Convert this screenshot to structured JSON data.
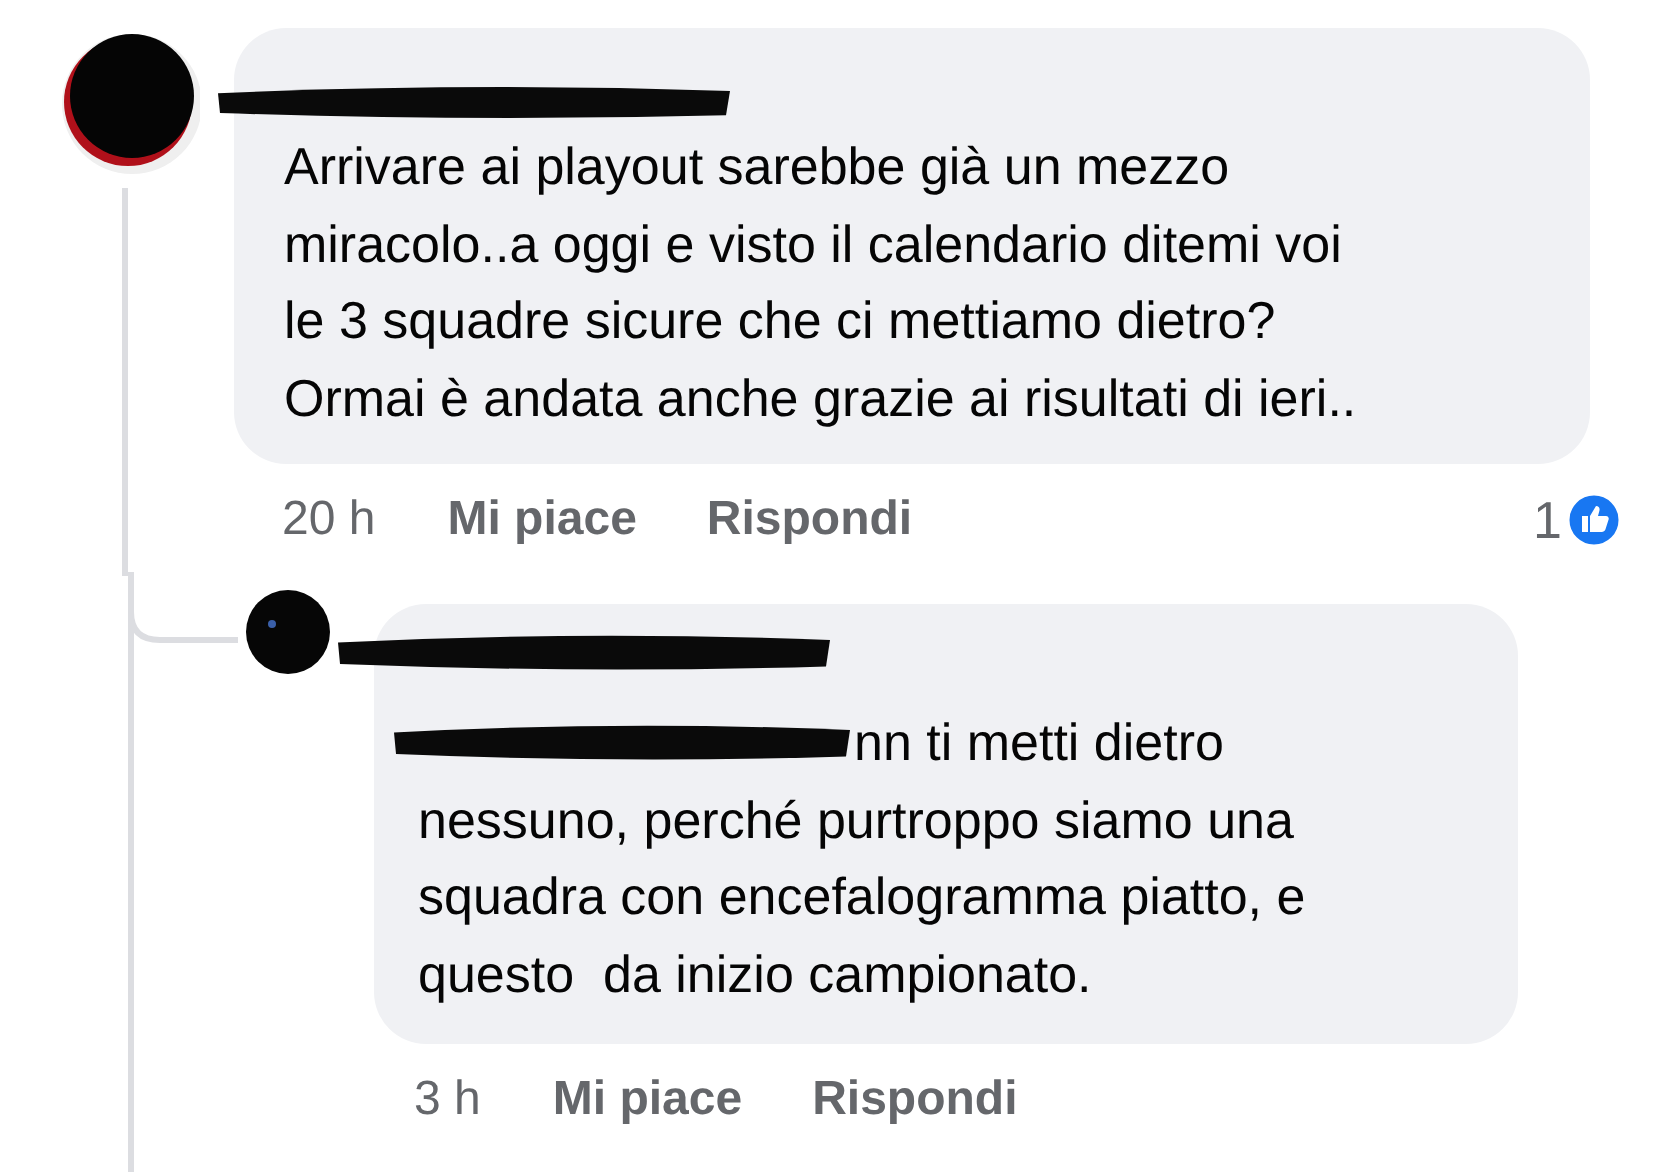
{
  "comments": [
    {
      "lines": [
        "Arrivare ai playout sarebbe già un mezzo",
        "miracolo..a oggi e visto il calendario ditemi voi",
        "le 3 squadre sicure che ci mettiamo dietro?",
        "Ormai è andata anche grazie ai risultati di ieri.."
      ],
      "time": "20 h",
      "like_label": "Mi piace",
      "reply_label": "Rispondi",
      "reaction_count": "1",
      "replies": [
        {
          "lines": [
            "nn ti metti dietro",
            "nessuno, perché purtroppo siamo una",
            "squadra con encefalogramma piatto, e",
            "questo  da inizio campionato."
          ],
          "time": "3 h",
          "like_label": "Mi piace",
          "reply_label": "Rispondi"
        }
      ]
    }
  ]
}
